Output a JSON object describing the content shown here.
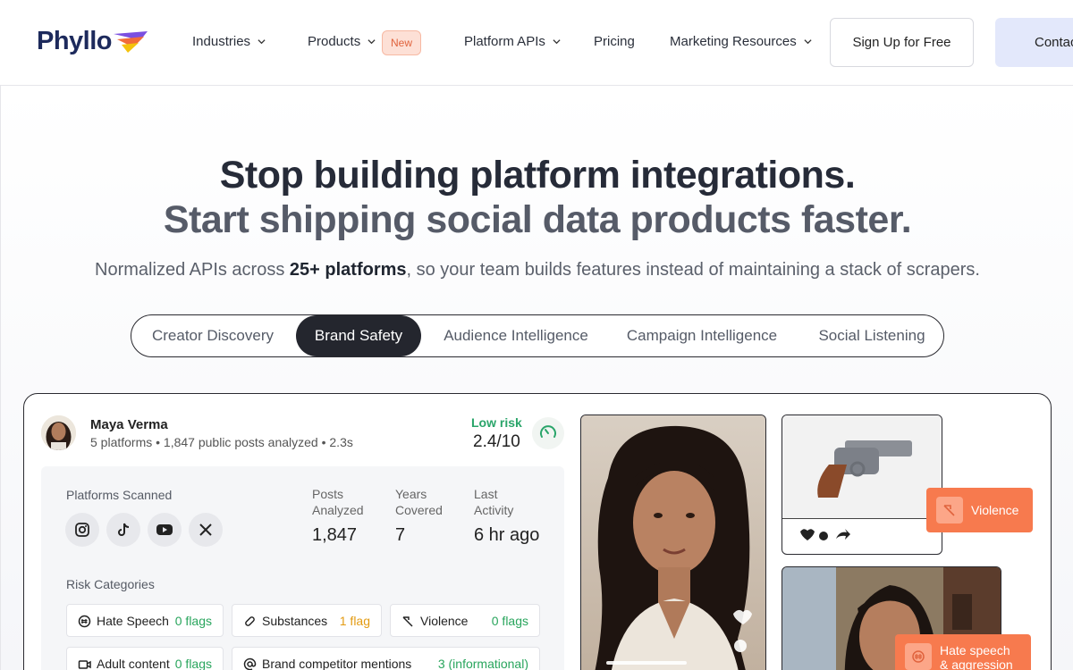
{
  "nav": {
    "logo_text": "Phyllo",
    "items": [
      {
        "label": "Industries"
      },
      {
        "label": "Products"
      },
      {
        "label": "Platform APIs"
      },
      {
        "label": "Pricing"
      },
      {
        "label": "Marketing Resources"
      }
    ],
    "new_badge": "New",
    "signup_label": "Sign Up for Free",
    "contact_label": "Contac"
  },
  "hero": {
    "headline": "Stop building platform integrations.",
    "headline2": "Start shipping social data products faster.",
    "sub_pre": "Normalized APIs across ",
    "sub_bold": "25+ platforms",
    "sub_post": ", so your team builds features instead of maintaining a stack of scrapers."
  },
  "tabs": [
    {
      "label": "Creator Discovery"
    },
    {
      "label": "Brand Safety"
    },
    {
      "label": "Audience Intelligence"
    },
    {
      "label": "Campaign Intelligence"
    },
    {
      "label": "Social Listening"
    }
  ],
  "active_tab": "Brand Safety",
  "profile": {
    "name": "Maya Verma",
    "meta": "5 platforms • 1,847 public posts analyzed • 2.3s",
    "risk_label": "Low risk",
    "risk_value": "2.4/10"
  },
  "panel": {
    "platforms_label": "Platforms Scanned",
    "platform_icons": [
      "instagram-icon",
      "tiktok-icon",
      "youtube-icon",
      "x-icon"
    ],
    "stats": [
      {
        "label_line1": "Posts",
        "label_line2": "Analyzed",
        "value": "1,847"
      },
      {
        "label_line1": "Years",
        "label_line2": "Covered",
        "value": "7"
      },
      {
        "label_line1": "Last",
        "label_line2": "Activity",
        "value": "6 hr ago"
      }
    ],
    "risk_categories_label": "Risk Categories",
    "categories": [
      {
        "label": "Hate Speech",
        "flags": "0 flags",
        "icon": "hate-speech-icon"
      },
      {
        "label": "Substances",
        "flags": "1 flag",
        "icon": "substances-icon"
      },
      {
        "label": "Violence",
        "flags": "0 flags",
        "icon": "violence-icon"
      },
      {
        "label": "Adult content",
        "flags": "0 flags",
        "icon": "adult-content-icon"
      },
      {
        "label": "Brand competitor mentions",
        "flags": "3 (informational)",
        "icon": "at-icon"
      }
    ]
  },
  "tags": {
    "violence": "Violence",
    "hate_line1": "Hate speech",
    "hate_line2": "& aggression"
  },
  "colors": {
    "brand_navy": "#1d2a5c",
    "accent_orange": "#f77a4e",
    "low_risk_green": "#2aa56a",
    "flag_orange": "#e39b13",
    "active_tab_bg": "#24262e"
  }
}
